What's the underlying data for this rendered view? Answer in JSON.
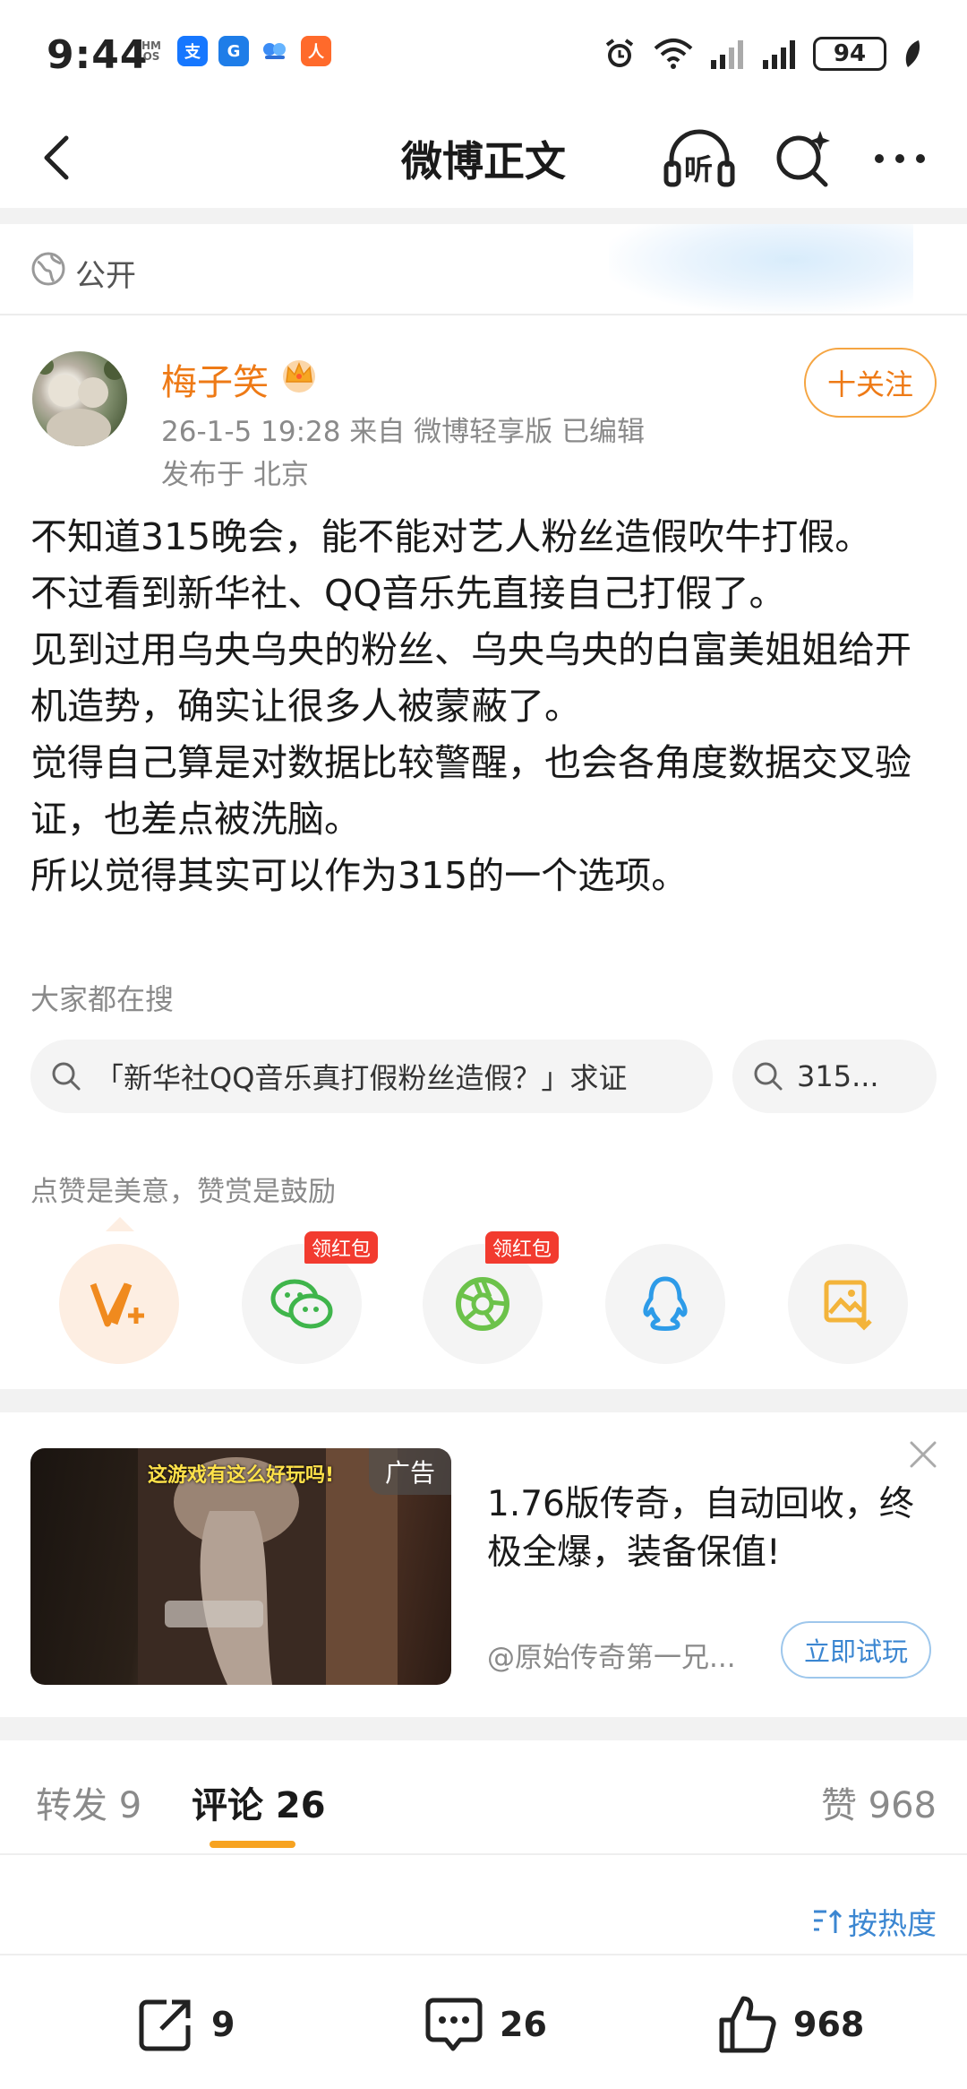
{
  "status_bar": {
    "time": "9:44",
    "battery": "94",
    "app_icons": [
      {
        "name": "hmos-icon",
        "label": "HM OS",
        "color": "#ffffff"
      },
      {
        "name": "alipay-icon",
        "label": "支",
        "color": "#1677ff"
      },
      {
        "name": "gf-icon",
        "label": "G",
        "color": "#1e7de8"
      },
      {
        "name": "baidu-netdisk-icon",
        "label": "◆",
        "color": "#3b8cf5"
      },
      {
        "name": "taobao-icon",
        "label": "人",
        "color": "#ff6a2b"
      }
    ]
  },
  "nav": {
    "title": "微博正文",
    "listen_label": "听"
  },
  "visibility": {
    "label": "公开"
  },
  "post": {
    "author": "梅子笑",
    "meta": "26-1-5 19:28   来自 微博轻享版   已编辑",
    "location": "发布于 北京",
    "follow_label": "十关注",
    "paragraphs": [
      "不知道315晚会，能不能对艺人粉丝造假吹牛打假。",
      "不过看到新华社、QQ音乐先直接自己打假了。",
      "见到过用乌央乌央的粉丝、乌央乌央的白富美姐姐给开机造势，确实让很多人被蒙蔽了。",
      "觉得自己算是对数据比较警醒，也会各角度数据交叉验证，也差点被洗脑。",
      "所以觉得其实可以作为315的一个选项。"
    ]
  },
  "search": {
    "title": "大家都在搜",
    "chips": [
      "「新华社QQ音乐真打假粉丝造假？」求证",
      "315..."
    ]
  },
  "reward": {
    "hint": "点赞是美意，赞赏是鼓励",
    "redpack_label": "领红包",
    "share_items": [
      {
        "name": "reward-v-icon"
      },
      {
        "name": "wechat-icon"
      },
      {
        "name": "moments-icon"
      },
      {
        "name": "qq-icon"
      },
      {
        "name": "save-image-icon"
      }
    ]
  },
  "ad": {
    "overlay_text": "这游戏有这么好玩吗!",
    "tag": "广告",
    "title": "1.76版传奇，自动回收，终极全爆，装备保值!",
    "source": "@原始传奇第一兄...",
    "button": "立即试玩"
  },
  "tabs": {
    "repost": "转发 9",
    "comments": "评论 26",
    "likes": "赞 968"
  },
  "sort": {
    "label": "按热度"
  },
  "bottom_bar": {
    "repost_count": "9",
    "comment_count": "26",
    "like_count": "968"
  },
  "colors": {
    "accent_orange": "#ee7a16",
    "link_blue": "#3b86d1",
    "tab_underline": "#f7a320",
    "redpack": "#f23b2f"
  }
}
